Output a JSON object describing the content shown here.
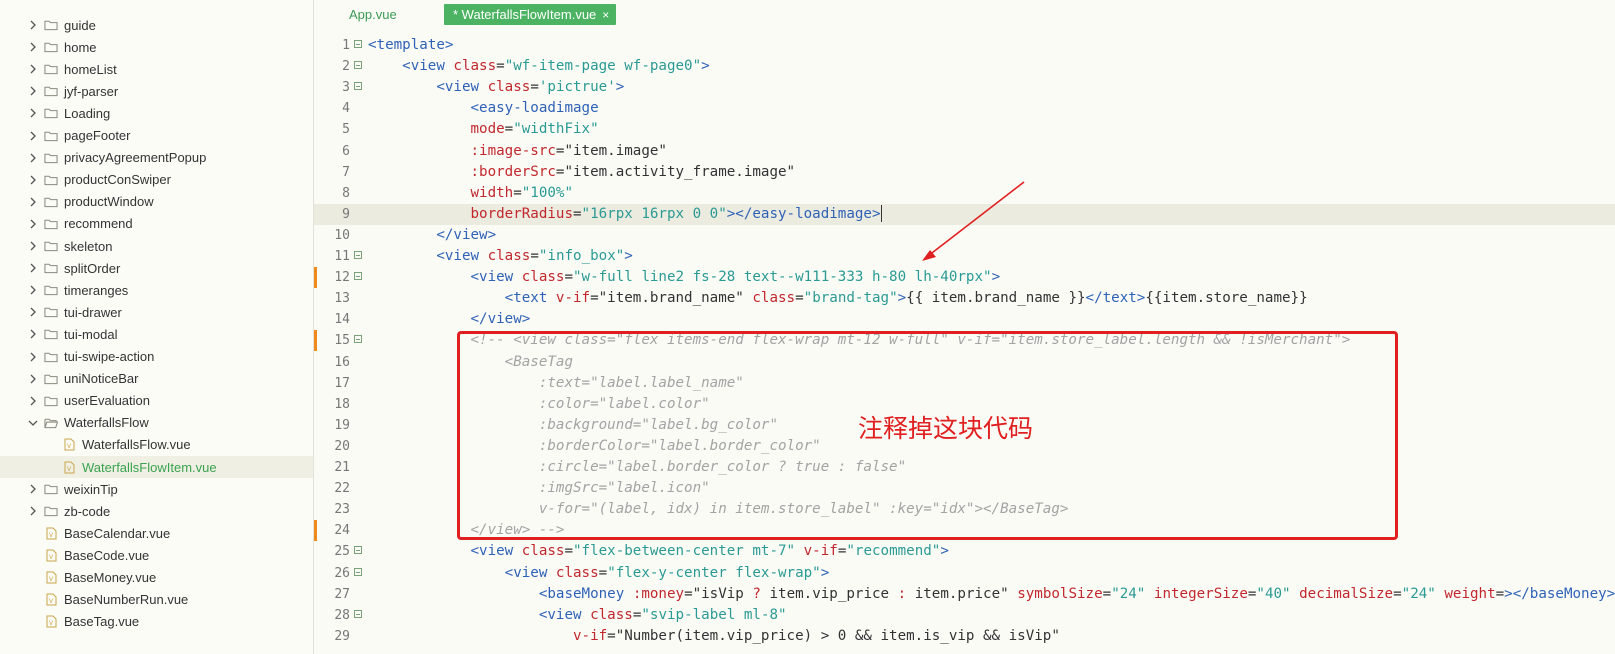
{
  "sidebar": {
    "items": [
      {
        "label": "guide",
        "kind": "folder",
        "expanded": false
      },
      {
        "label": "home",
        "kind": "folder",
        "expanded": false
      },
      {
        "label": "homeList",
        "kind": "folder",
        "expanded": false
      },
      {
        "label": "jyf-parser",
        "kind": "folder",
        "expanded": false
      },
      {
        "label": "Loading",
        "kind": "folder",
        "expanded": false
      },
      {
        "label": "pageFooter",
        "kind": "folder",
        "expanded": false
      },
      {
        "label": "privacyAgreementPopup",
        "kind": "folder",
        "expanded": false
      },
      {
        "label": "productConSwiper",
        "kind": "folder",
        "expanded": false
      },
      {
        "label": "productWindow",
        "kind": "folder",
        "expanded": false
      },
      {
        "label": "recommend",
        "kind": "folder",
        "expanded": false
      },
      {
        "label": "skeleton",
        "kind": "folder",
        "expanded": false
      },
      {
        "label": "splitOrder",
        "kind": "folder",
        "expanded": false
      },
      {
        "label": "timeranges",
        "kind": "folder",
        "expanded": false
      },
      {
        "label": "tui-drawer",
        "kind": "folder",
        "expanded": false
      },
      {
        "label": "tui-modal",
        "kind": "folder",
        "expanded": false
      },
      {
        "label": "tui-swipe-action",
        "kind": "folder",
        "expanded": false
      },
      {
        "label": "uniNoticeBar",
        "kind": "folder",
        "expanded": false
      },
      {
        "label": "userEvaluation",
        "kind": "folder",
        "expanded": false
      },
      {
        "label": "WaterfallsFlow",
        "kind": "folder",
        "expanded": true
      },
      {
        "label": "WaterfallsFlow.vue",
        "kind": "file",
        "depth": 1
      },
      {
        "label": "WaterfallsFlowItem.vue",
        "kind": "file",
        "depth": 1,
        "active": true
      },
      {
        "label": "weixinTip",
        "kind": "folder",
        "expanded": false
      },
      {
        "label": "zb-code",
        "kind": "folder",
        "expanded": false
      },
      {
        "label": "BaseCalendar.vue",
        "kind": "file",
        "depth": 0
      },
      {
        "label": "BaseCode.vue",
        "kind": "file",
        "depth": 0
      },
      {
        "label": "BaseMoney.vue",
        "kind": "file",
        "depth": 0
      },
      {
        "label": "BaseNumberRun.vue",
        "kind": "file",
        "depth": 0
      },
      {
        "label": "BaseTag.vue",
        "kind": "file",
        "depth": 0
      }
    ]
  },
  "tabs": {
    "app": "App.vue",
    "active": "* WaterfallsFlowItem.vue",
    "close_icon": "×"
  },
  "editor": {
    "lines": [
      {
        "n": "1",
        "fold": true,
        "segs": [
          [
            "t",
            "<template>"
          ]
        ]
      },
      {
        "n": "2",
        "fold": true,
        "segs": [
          [
            "p",
            "    "
          ],
          [
            "t",
            "<view "
          ],
          [
            "a",
            "class"
          ],
          [
            "p",
            "="
          ],
          [
            "s",
            "\"wf-item-page wf-page0\""
          ],
          [
            "t",
            ">"
          ]
        ]
      },
      {
        "n": "3",
        "fold": true,
        "segs": [
          [
            "p",
            "        "
          ],
          [
            "t",
            "<view "
          ],
          [
            "a",
            "class"
          ],
          [
            "p",
            "="
          ],
          [
            "s",
            "'pictrue'"
          ],
          [
            "t",
            ">"
          ]
        ]
      },
      {
        "n": "4",
        "segs": [
          [
            "p",
            "            "
          ],
          [
            "t",
            "<easy-loadimage"
          ]
        ]
      },
      {
        "n": "5",
        "segs": [
          [
            "p",
            "            "
          ],
          [
            "a",
            "mode"
          ],
          [
            "p",
            "="
          ],
          [
            "s",
            "\"widthFix\""
          ]
        ]
      },
      {
        "n": "6",
        "segs": [
          [
            "p",
            "            "
          ],
          [
            "a",
            ":image-src"
          ],
          [
            "p",
            "=\"item.image\""
          ]
        ]
      },
      {
        "n": "7",
        "segs": [
          [
            "p",
            "            "
          ],
          [
            "a",
            ":borderSrc"
          ],
          [
            "p",
            "=\"item.activity_frame.image\""
          ]
        ]
      },
      {
        "n": "8",
        "segs": [
          [
            "p",
            "            "
          ],
          [
            "a",
            "width"
          ],
          [
            "p",
            "="
          ],
          [
            "s",
            "\"100%\""
          ]
        ]
      },
      {
        "n": "9",
        "current": true,
        "cursor": true,
        "segs": [
          [
            "p",
            "            "
          ],
          [
            "a",
            "borderRadius"
          ],
          [
            "p",
            "="
          ],
          [
            "s",
            "\"16rpx 16rpx 0 0\""
          ],
          [
            "t",
            "></easy-loadimage>"
          ]
        ]
      },
      {
        "n": "10",
        "segs": [
          [
            "p",
            "        "
          ],
          [
            "t",
            "</view>"
          ]
        ]
      },
      {
        "n": "11",
        "fold": true,
        "segs": [
          [
            "p",
            "        "
          ],
          [
            "t",
            "<view "
          ],
          [
            "a",
            "class"
          ],
          [
            "p",
            "="
          ],
          [
            "s",
            "\"info_box\""
          ],
          [
            "t",
            ">"
          ]
        ]
      },
      {
        "n": "12",
        "fold": true,
        "mark": true,
        "segs": [
          [
            "p",
            "            "
          ],
          [
            "t",
            "<view "
          ],
          [
            "a",
            "class"
          ],
          [
            "p",
            "="
          ],
          [
            "s",
            "\"w-full line2 fs-28 text--w111-333 h-80 lh-40rpx\""
          ],
          [
            "t",
            ">"
          ]
        ]
      },
      {
        "n": "13",
        "segs": [
          [
            "p",
            "                "
          ],
          [
            "t",
            "<text "
          ],
          [
            "a",
            "v-if"
          ],
          [
            "p",
            "=\"item.brand_name\" "
          ],
          [
            "a",
            "class"
          ],
          [
            "p",
            "="
          ],
          [
            "s",
            "\"brand-tag\""
          ],
          [
            "t",
            ">"
          ],
          [
            "p",
            "{{ item.brand_name }}"
          ],
          [
            "t",
            "</text>"
          ],
          [
            "p",
            "{{item.store_name}}"
          ]
        ]
      },
      {
        "n": "14",
        "segs": [
          [
            "p",
            "            "
          ],
          [
            "t",
            "</view>"
          ]
        ]
      },
      {
        "n": "15",
        "fold": true,
        "mark": true,
        "segs": [
          [
            "p",
            "            "
          ],
          [
            "c",
            "<!-- <view class=\"flex items-end flex-wrap mt-12 w-full\" v-if=\"item.store_label.length && !isMerchant\">"
          ]
        ]
      },
      {
        "n": "16",
        "segs": [
          [
            "p",
            "                "
          ],
          [
            "c",
            "<BaseTag"
          ]
        ]
      },
      {
        "n": "17",
        "segs": [
          [
            "p",
            "                    "
          ],
          [
            "c",
            ":text=\"label.label_name\""
          ]
        ]
      },
      {
        "n": "18",
        "segs": [
          [
            "p",
            "                    "
          ],
          [
            "c",
            ":color=\"label.color\""
          ]
        ]
      },
      {
        "n": "19",
        "segs": [
          [
            "p",
            "                    "
          ],
          [
            "c",
            ":background=\"label.bg_color\""
          ]
        ]
      },
      {
        "n": "20",
        "segs": [
          [
            "p",
            "                    "
          ],
          [
            "c",
            ":borderColor=\"label.border_color\""
          ]
        ]
      },
      {
        "n": "21",
        "segs": [
          [
            "p",
            "                    "
          ],
          [
            "c",
            ":circle=\"label.border_color ? true : false\""
          ]
        ]
      },
      {
        "n": "22",
        "segs": [
          [
            "p",
            "                    "
          ],
          [
            "c",
            ":imgSrc=\"label.icon\""
          ]
        ]
      },
      {
        "n": "23",
        "segs": [
          [
            "p",
            "                    "
          ],
          [
            "c",
            "v-for=\"(label, idx) in item.store_label\" :key=\"idx\"></BaseTag>"
          ]
        ]
      },
      {
        "n": "24",
        "mark": true,
        "segs": [
          [
            "p",
            "            "
          ],
          [
            "c",
            "</view> -->"
          ]
        ]
      },
      {
        "n": "25",
        "fold": true,
        "segs": [
          [
            "p",
            "            "
          ],
          [
            "t",
            "<view "
          ],
          [
            "a",
            "class"
          ],
          [
            "p",
            "="
          ],
          [
            "s",
            "\"flex-between-center mt-7\" "
          ],
          [
            "a",
            "v-if"
          ],
          [
            "p",
            "="
          ],
          [
            "s",
            "\"recommend\""
          ],
          [
            "t",
            ">"
          ]
        ]
      },
      {
        "n": "26",
        "fold": true,
        "segs": [
          [
            "p",
            "                "
          ],
          [
            "t",
            "<view "
          ],
          [
            "a",
            "class"
          ],
          [
            "p",
            "="
          ],
          [
            "s",
            "\"flex-y-center flex-wrap\""
          ],
          [
            "t",
            ">"
          ]
        ]
      },
      {
        "n": "27",
        "segs": [
          [
            "p",
            "                    "
          ],
          [
            "t",
            "<baseMoney "
          ],
          [
            "a",
            ":money"
          ],
          [
            "p",
            "=\"isVip "
          ],
          [
            "a",
            "?"
          ],
          [
            "p",
            " item.vip_price "
          ],
          [
            "a",
            ":"
          ],
          [
            "p",
            " item.price\" "
          ],
          [
            "a",
            "symbolSize"
          ],
          [
            "p",
            "="
          ],
          [
            "s",
            "\"24\" "
          ],
          [
            "a",
            "integerSize"
          ],
          [
            "p",
            "="
          ],
          [
            "s",
            "\"40\" "
          ],
          [
            "a",
            "decimalSize"
          ],
          [
            "p",
            "="
          ],
          [
            "s",
            "\"24\" "
          ],
          [
            "a",
            "weight"
          ],
          [
            "p",
            "="
          ],
          [
            "t",
            "></baseMoney>"
          ]
        ]
      },
      {
        "n": "28",
        "fold": true,
        "segs": [
          [
            "p",
            "                    "
          ],
          [
            "t",
            "<view "
          ],
          [
            "a",
            "class"
          ],
          [
            "p",
            "="
          ],
          [
            "s",
            "\"svip-label ml-8\""
          ]
        ]
      },
      {
        "n": "29",
        "segs": [
          [
            "p",
            "                        "
          ],
          [
            "a",
            "v-if"
          ],
          [
            "p",
            "=\"Number(item.vip_price) > 0 && item.is_vip && isVip\""
          ]
        ]
      }
    ]
  },
  "annotation": {
    "text": "注释掉这块代码"
  },
  "colors": {
    "annotation_red": "#e02020",
    "active_tab": "#4bb361",
    "active_file": "#3aa34f"
  }
}
